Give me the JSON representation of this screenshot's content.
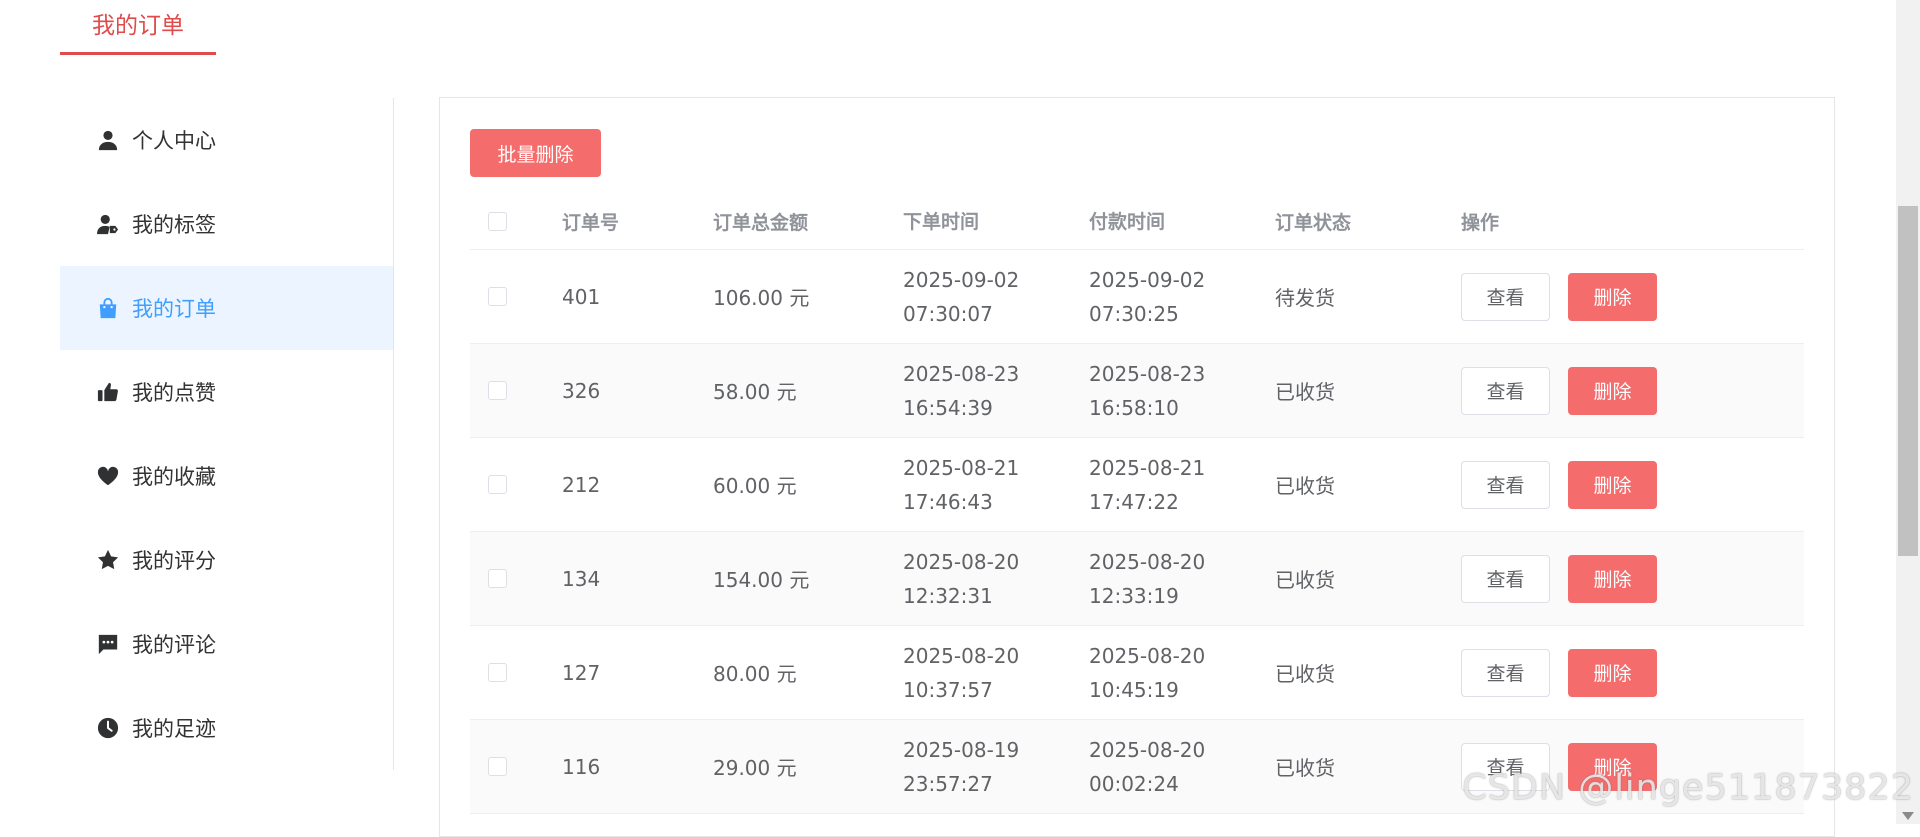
{
  "page_tab": {
    "title": "我的订单"
  },
  "sidebar": {
    "items": [
      {
        "label": "个人中心",
        "icon": "user-icon",
        "active": false
      },
      {
        "label": "我的标签",
        "icon": "user-tag-icon",
        "active": false
      },
      {
        "label": "我的订单",
        "icon": "shopping-bag-icon",
        "active": true
      },
      {
        "label": "我的点赞",
        "icon": "thumbs-up-icon",
        "active": false
      },
      {
        "label": "我的收藏",
        "icon": "heart-icon",
        "active": false
      },
      {
        "label": "我的评分",
        "icon": "star-icon",
        "active": false
      },
      {
        "label": "我的评论",
        "icon": "comment-icon",
        "active": false
      },
      {
        "label": "我的足迹",
        "icon": "clock-icon",
        "active": false
      }
    ]
  },
  "toolbar": {
    "bulk_delete_label": "批量删除"
  },
  "table": {
    "headers": {
      "order_no": "订单号",
      "total": "订单总金额",
      "order_time": "下单时间",
      "pay_time": "付款时间",
      "status": "订单状态",
      "actions": "操作"
    },
    "rows": [
      {
        "order_no": "401",
        "total": "106.00 元",
        "order_date": "2025-09-02",
        "order_clock": "07:30:07",
        "pay_date": "2025-09-02",
        "pay_clock": "07:30:25",
        "status": "待发货"
      },
      {
        "order_no": "326",
        "total": "58.00 元",
        "order_date": "2025-08-23",
        "order_clock": "16:54:39",
        "pay_date": "2025-08-23",
        "pay_clock": "16:58:10",
        "status": "已收货"
      },
      {
        "order_no": "212",
        "total": "60.00 元",
        "order_date": "2025-08-21",
        "order_clock": "17:46:43",
        "pay_date": "2025-08-21",
        "pay_clock": "17:47:22",
        "status": "已收货"
      },
      {
        "order_no": "134",
        "total": "154.00 元",
        "order_date": "2025-08-20",
        "order_clock": "12:32:31",
        "pay_date": "2025-08-20",
        "pay_clock": "12:33:19",
        "status": "已收货"
      },
      {
        "order_no": "127",
        "total": "80.00 元",
        "order_date": "2025-08-20",
        "order_clock": "10:37:57",
        "pay_date": "2025-08-20",
        "pay_clock": "10:45:19",
        "status": "已收货"
      },
      {
        "order_no": "116",
        "total": "29.00 元",
        "order_date": "2025-08-19",
        "order_clock": "23:57:27",
        "pay_date": "2025-08-20",
        "pay_clock": "00:02:24",
        "status": "已收货"
      }
    ],
    "view_label": "查看",
    "delete_label": "删除"
  },
  "watermark": "CSDN @linge511873822",
  "colors": {
    "accent_red": "#f56c6c",
    "active_blue": "#409eff",
    "active_bg": "#ecf5ff",
    "tab_red": "#e04b4b"
  }
}
